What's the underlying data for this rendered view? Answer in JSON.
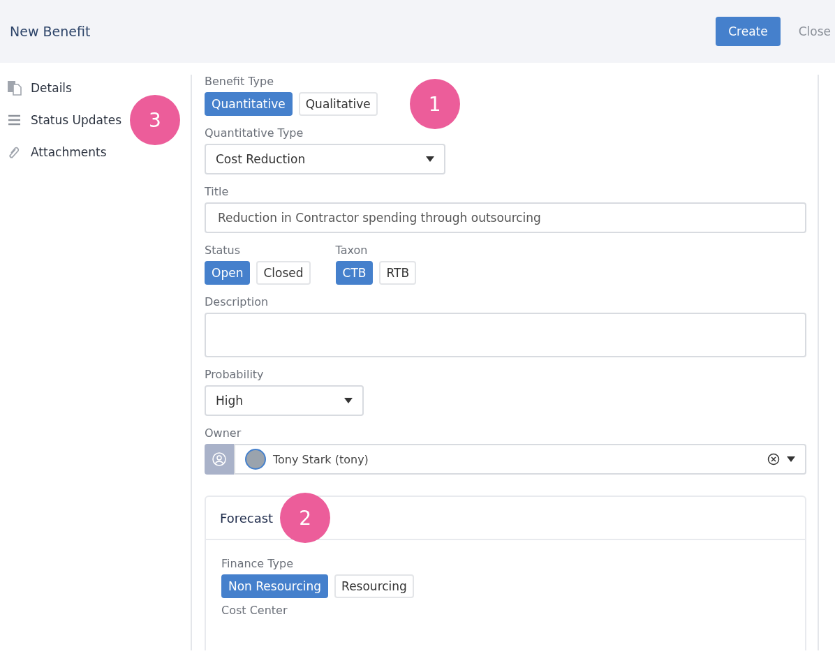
{
  "header": {
    "title": "New Benefit",
    "buttons": [
      {
        "label": "Create",
        "kind": "primary"
      },
      {
        "label": "Close",
        "kind": "link"
      }
    ]
  },
  "sidebar": {
    "items": [
      {
        "label": "Details",
        "kind": "pages"
      },
      {
        "label": "Status Updates",
        "kind": "lines",
        "callout": "3"
      },
      {
        "label": "Attachments",
        "kind": "clip"
      }
    ]
  },
  "benefit_type": {
    "label": "Benefit Type",
    "callout": "1",
    "options": [
      {
        "label": "Quantitative",
        "selected": true
      },
      {
        "label": "Qualitative",
        "selected": false
      }
    ]
  },
  "quantitative_type": {
    "label": "Quantitative Type",
    "value": "Cost Reduction"
  },
  "title": {
    "label": "Title",
    "value": "Reduction in Contractor spending through outsourcing"
  },
  "status": {
    "label": "Status",
    "options": [
      {
        "label": "Open",
        "selected": true
      },
      {
        "label": "Closed",
        "selected": false
      }
    ]
  },
  "taxon": {
    "label": "Taxon",
    "options": [
      {
        "label": "CTB",
        "selected": true
      },
      {
        "label": "RTB",
        "selected": false
      }
    ]
  },
  "description": {
    "label": "Description"
  },
  "probability": {
    "label": "Probability",
    "value": "High"
  },
  "owner": {
    "label": "Owner",
    "value": "Tony Stark (tony)"
  },
  "forecast": {
    "title": "Forecast",
    "callout": "2",
    "finance_type": {
      "label": "Finance Type",
      "options": [
        {
          "label": "Non Resourcing",
          "selected": true
        },
        {
          "label": "Resourcing",
          "selected": false
        }
      ]
    },
    "cost_center": {
      "label": "Cost Center"
    }
  }
}
